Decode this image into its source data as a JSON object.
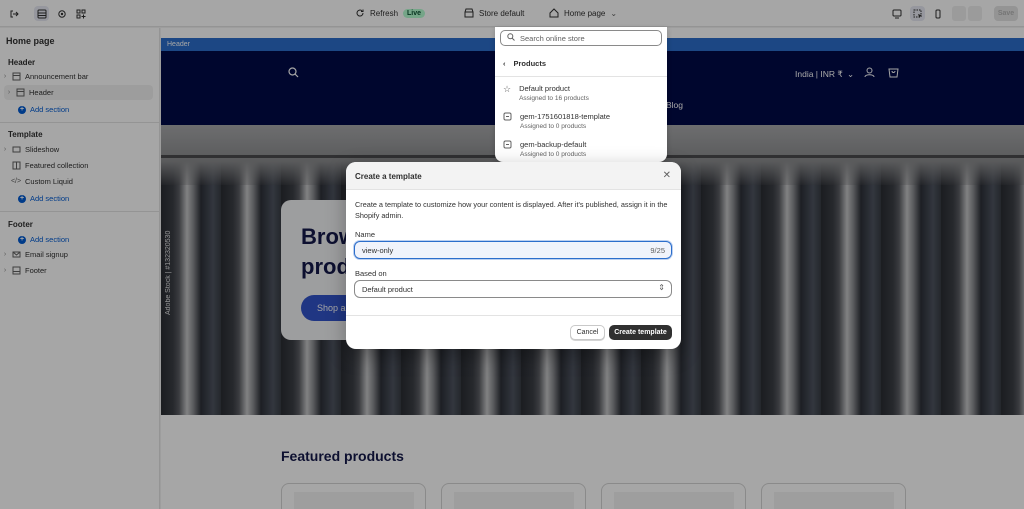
{
  "topbar": {
    "refresh_label": "Refresh",
    "live_badge": "Live",
    "store_label": "Store default",
    "page_label": "Home page",
    "save_label": "Save"
  },
  "sidebar": {
    "title": "Home page",
    "groups": {
      "header": {
        "label": "Header",
        "items": [
          "Announcement bar",
          "Header"
        ],
        "add_label": "Add section"
      },
      "template": {
        "label": "Template",
        "items": [
          "Slideshow",
          "Featured collection",
          "Custom Liquid"
        ],
        "add_label": "Add section"
      },
      "footer": {
        "label": "Footer",
        "add_label": "Add section",
        "items": [
          "Email signup",
          "Footer"
        ]
      }
    }
  },
  "preview": {
    "section_tag": "Header",
    "locale": "India | INR ₹",
    "nav_blog": "Blog",
    "hero_heading_1": "Brow",
    "hero_heading_2": "produ",
    "hero_button": "Shop a",
    "watermark": "Adobe Stock | #132320530",
    "featured_title": "Featured products"
  },
  "dropdown": {
    "search_placeholder": "Search online store",
    "back_label": "Products",
    "items": [
      {
        "title": "Default product",
        "subtitle": "Assigned to 16 products"
      },
      {
        "title": "gem-1751601818-template",
        "subtitle": "Assigned to 0 products"
      },
      {
        "title": "gem-backup-default",
        "subtitle": "Assigned to 0 products"
      }
    ]
  },
  "modal": {
    "title": "Create a template",
    "description": "Create a template to customize how your content is displayed. After it's published, assign it in the Shopify admin.",
    "name_label": "Name",
    "name_value": "view-only",
    "name_counter": "9/25",
    "based_on_label": "Based on",
    "based_on_value": "Default product",
    "cancel_label": "Cancel",
    "create_label": "Create template"
  },
  "colors": {
    "accent": "#005bd3",
    "header_bg": "#000a48",
    "primary_button": "#303030",
    "live_badge": "#b4fed2"
  }
}
